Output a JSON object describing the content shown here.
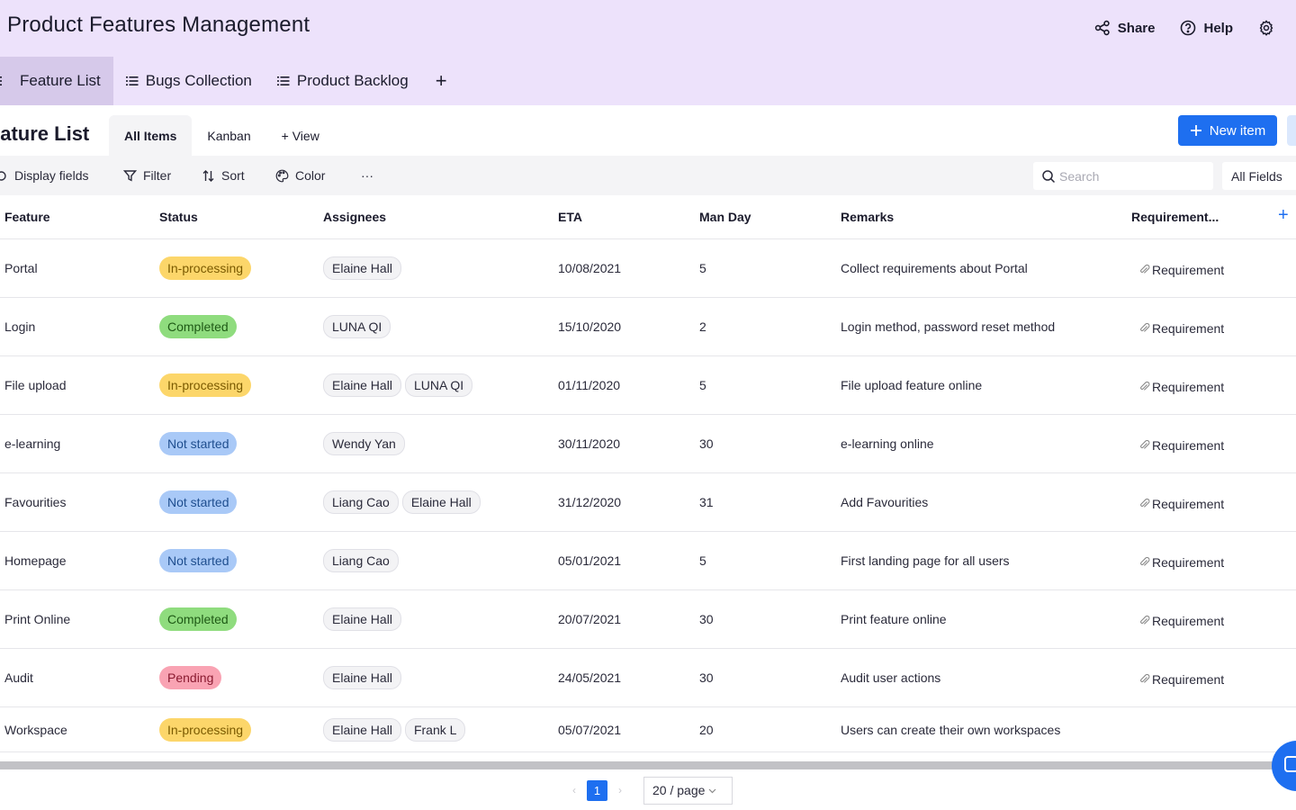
{
  "app": {
    "title": "Product Features Management"
  },
  "header": {
    "share_label": "Share",
    "help_label": "Help"
  },
  "sheet_tabs": [
    {
      "label": "Feature List",
      "icon": "list-icon",
      "active": true
    },
    {
      "label": "Bugs Collection",
      "icon": "list-icon",
      "active": false
    },
    {
      "label": "Product Backlog",
      "icon": "list-icon",
      "active": false
    }
  ],
  "view": {
    "title": "eature List",
    "tabs": [
      {
        "label": "All Items",
        "active": true
      },
      {
        "label": "Kanban",
        "active": false
      },
      {
        "label": "+ View",
        "active": false
      }
    ],
    "new_item_label": "New item"
  },
  "toolbar": {
    "display_fields": "Display fields",
    "filter": "Filter",
    "sort": "Sort",
    "color": "Color",
    "more": "···",
    "search_placeholder": "Search",
    "field_select": "All Fields"
  },
  "table": {
    "columns": [
      "Feature",
      "Status",
      "Assignees",
      "ETA",
      "Man Day",
      "Remarks",
      "Requirement..."
    ],
    "rows": [
      {
        "feature": "Portal",
        "status": "In-processing",
        "assignees": [
          "Elaine Hall"
        ],
        "eta": "10/08/2021",
        "man_day": "5",
        "remarks": "Collect requirements about Portal",
        "requirement": "Requirement"
      },
      {
        "feature": "Login",
        "status": "Completed",
        "assignees": [
          "LUNA QI"
        ],
        "eta": "15/10/2020",
        "man_day": "2",
        "remarks": "Login method, password reset method",
        "requirement": "Requirement"
      },
      {
        "feature": "File upload",
        "status": "In-processing",
        "assignees": [
          "Elaine Hall",
          "LUNA QI"
        ],
        "eta": "01/11/2020",
        "man_day": "5",
        "remarks": "File upload feature online",
        "requirement": "Requirement"
      },
      {
        "feature": "e-learning",
        "status": "Not started",
        "assignees": [
          "Wendy Yan"
        ],
        "eta": "30/11/2020",
        "man_day": "30",
        "remarks": "e-learning online",
        "requirement": "Requirement"
      },
      {
        "feature": "Favourities",
        "status": "Not started",
        "assignees": [
          "Liang Cao",
          "Elaine Hall"
        ],
        "eta": "31/12/2020",
        "man_day": "31",
        "remarks": "Add Favourities",
        "requirement": "Requirement"
      },
      {
        "feature": "Homepage",
        "status": "Not started",
        "assignees": [
          "Liang Cao"
        ],
        "eta": "05/01/2021",
        "man_day": "5",
        "remarks": "First landing page for all users",
        "requirement": "Requirement"
      },
      {
        "feature": "Print Online",
        "status": "Completed",
        "assignees": [
          "Elaine Hall"
        ],
        "eta": "20/07/2021",
        "man_day": "30",
        "remarks": "Print feature online",
        "requirement": "Requirement"
      },
      {
        "feature": "Audit",
        "status": "Pending",
        "assignees": [
          "Elaine Hall"
        ],
        "eta": "24/05/2021",
        "man_day": "30",
        "remarks": "Audit user actions",
        "requirement": "Requirement"
      },
      {
        "feature": "Workspace",
        "status": "In-processing",
        "assignees": [
          "Elaine Hall",
          "Frank L"
        ],
        "eta": "05/07/2021",
        "man_day": "20",
        "remarks": "Users can create their own workspaces",
        "requirement": ""
      }
    ]
  },
  "status_colors": {
    "In-processing": {
      "bg": "#fcd66a",
      "fg": "#7a5a00"
    },
    "Completed": {
      "bg": "#8fdc7e",
      "fg": "#1f5a16"
    },
    "Not started": {
      "bg": "#a9c9f7",
      "fg": "#1f4e8f"
    },
    "Pending": {
      "bg": "#f9a3b3",
      "fg": "#8a1a30"
    }
  },
  "pagination": {
    "current_page": "1",
    "page_size": "20 / page"
  },
  "colors": {
    "header_bg": "#ede2fb",
    "accent": "#1e6ff0"
  }
}
